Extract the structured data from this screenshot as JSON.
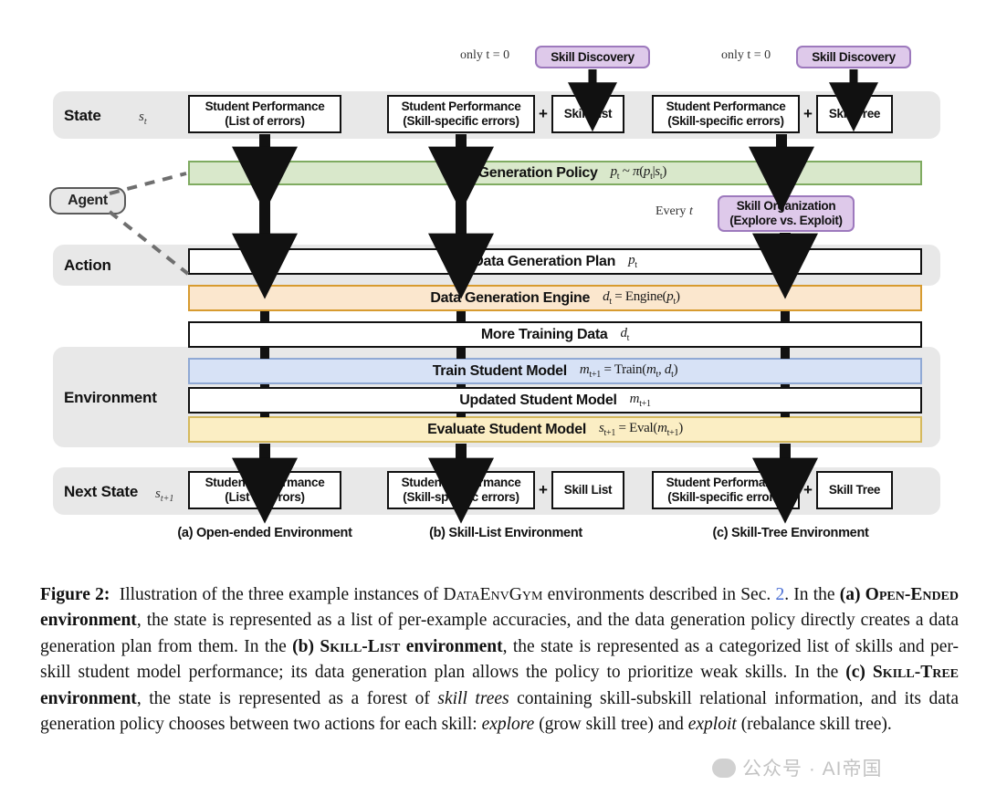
{
  "figure": {
    "rows": {
      "state": {
        "label": "State",
        "symbol": "s",
        "symbol_sub": "t"
      },
      "agent": {
        "label": "Agent"
      },
      "action": {
        "label": "Action"
      },
      "environment": {
        "label": "Environment"
      },
      "next_state": {
        "label": "Next State",
        "symbol": "s",
        "symbol_sub": "t+1"
      }
    },
    "discovery": {
      "note_a": "only t = 0",
      "note_b": "only t = 0",
      "label_a": "Skill Discovery",
      "label_b": "Skill Discovery"
    },
    "state_nodes": {
      "col_a": {
        "line1": "Student Performance",
        "line2": "(List of errors)"
      },
      "col_b_main": {
        "line1": "Student Performance",
        "line2": "(Skill-specific errors)"
      },
      "col_b_plus": "+",
      "col_b_side": "Skill List",
      "col_c_main": {
        "line1": "Student Performance",
        "line2": "(Skill-specific errors)"
      },
      "col_c_plus": "+",
      "col_c_side": "Skill Tree"
    },
    "next_state_nodes": {
      "col_a": {
        "line1": "Student Performance",
        "line2": "(List of errors)"
      },
      "col_b_main": {
        "line1": "Student Performance",
        "line2": "(Skill-specific errors)"
      },
      "col_b_plus": "+",
      "col_b_side": "Skill List",
      "col_c_main": {
        "line1": "Student Performance",
        "line2": "(Skill-specific errors)"
      },
      "col_c_plus": "+",
      "col_c_side": "Skill Tree"
    },
    "bars": {
      "policy": {
        "label": "Data Generation Policy",
        "math": "p_t ~ π(p_t|s_t)"
      },
      "plan": {
        "label": "Data Generation Plan",
        "math": "p_t"
      },
      "engine": {
        "label": "Data Generation Engine",
        "math": "d_t = Engine(p_t)"
      },
      "more_data": {
        "label": "More Training Data",
        "math": "d_t"
      },
      "train": {
        "label": "Train Student Model",
        "math": "m_t+1 = Train(m_t, d_t)"
      },
      "updated": {
        "label": "Updated Student Model",
        "math": "m_t+1"
      },
      "evaluate": {
        "label": "Evaluate Student Model",
        "math": "s_t+1 = Eval(m_t+1)"
      }
    },
    "skill_organization": {
      "note": "Every t",
      "line1": "Skill Organization",
      "line2": "(Explore vs. Exploit)"
    },
    "column_captions": [
      "(a) Open-ended Environment",
      "(b) Skill-List Environment",
      "(c) Skill-Tree Environment"
    ],
    "colors": {
      "band": "#e8e8e8",
      "green": "#d9e8cb",
      "green_border": "#7fab61",
      "orange": "#fbe7ce",
      "orange_border": "#d79b30",
      "blue": "#d7e2f6",
      "blue_border": "#90a9d4",
      "yellow": "#fbeec4",
      "yellow_border": "#d5b95e",
      "purple": "#dec9ea",
      "purple_border": "#9d79bd",
      "arrow": "#111111",
      "link": "#4a6fd4"
    }
  },
  "caption": {
    "prefix": "Figure 2:",
    "seg1": "Illustration of the three example instances of ",
    "sc1": "DataEnvGym",
    "seg2": " environments described in Sec. ",
    "ref": "2",
    "seg3": ". In the ",
    "b_a": "(a) ",
    "sc_a": "Open-Ended",
    "b_a2": " environment",
    "seg4": ", the state is represented as a list of per-example accuracies, and the data generation policy directly creates a data generation plan from them. In the ",
    "b_b": "(b) ",
    "sc_b": "Skill-List",
    "b_b2": " environment",
    "seg5": ", the state is represented as a categorized list of skills and per-skill student model performance; its data generation plan allows the policy to prioritize weak skills. In the ",
    "b_c": "(c) ",
    "sc_c": "Skill-Tree",
    "b_c2": " environment",
    "seg6": ", the state is represented as a forest of ",
    "i1": "skill trees",
    "seg7": " containing skill-subskill relational information, and its data generation policy chooses between two actions for each skill: ",
    "i2": "explore",
    "seg8": " (grow skill tree) and ",
    "i3": "exploit",
    "seg9": " (rebalance skill tree)."
  },
  "watermark": {
    "text": "公众号 · AI帝国"
  }
}
